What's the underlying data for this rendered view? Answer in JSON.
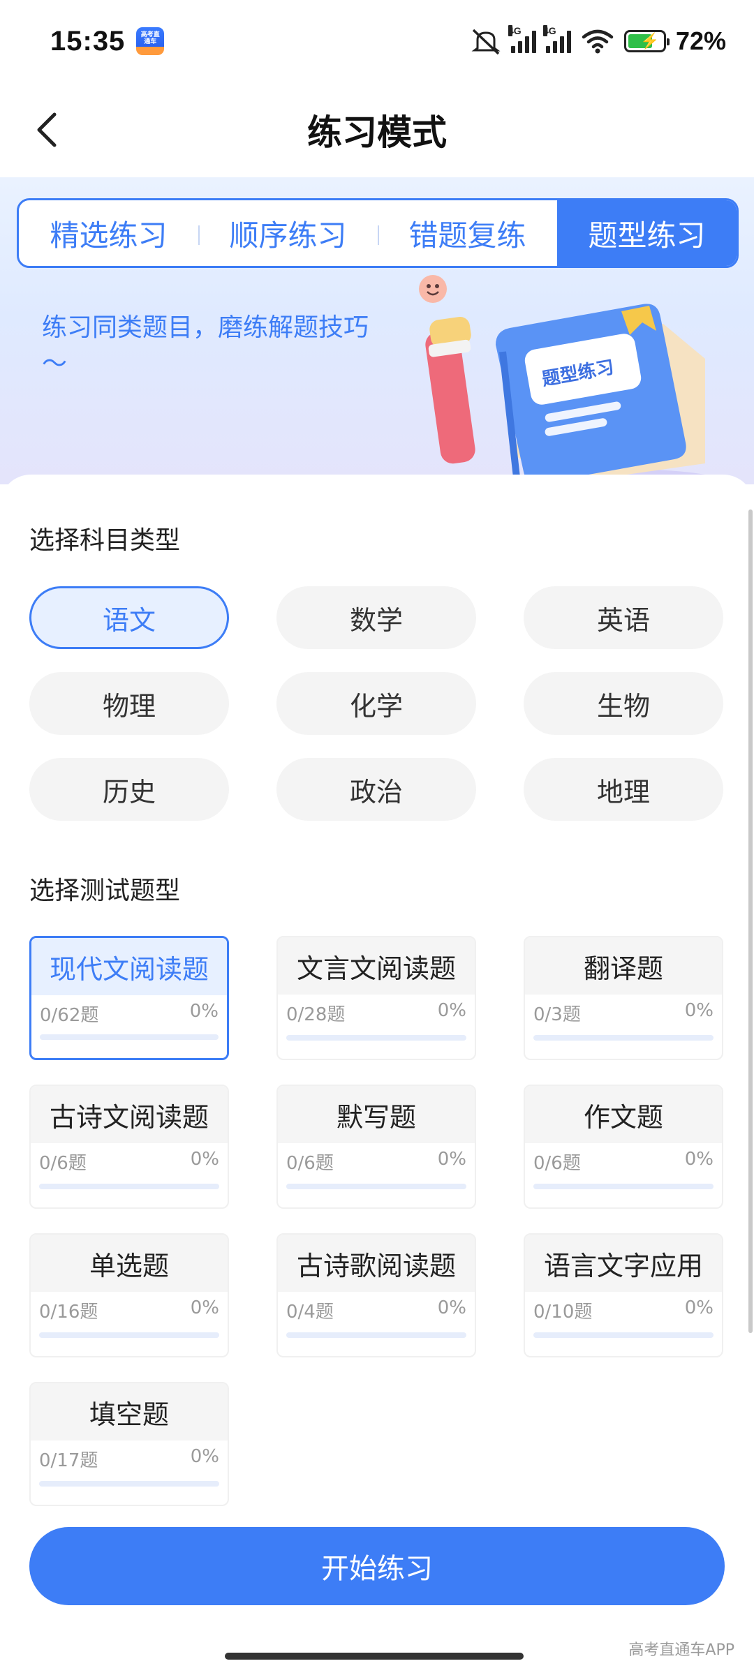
{
  "status_bar": {
    "time": "15:35",
    "app_icon_text": "高考直通车",
    "battery_percent": "72%",
    "battery_level": 0.72,
    "network_labels": [
      "4G",
      "4G"
    ],
    "icons": [
      "mute-icon",
      "signal-icon",
      "signal-icon",
      "wifi-icon",
      "battery-charging-icon"
    ]
  },
  "nav": {
    "back_icon": "chevron-left-icon",
    "title": "练习模式"
  },
  "hero": {
    "tabs": [
      {
        "label": "精选练习",
        "active": false
      },
      {
        "label": "顺序练习",
        "active": false
      },
      {
        "label": "错题复练",
        "active": false
      },
      {
        "label": "题型练习",
        "active": true
      }
    ],
    "description": "练习同类题目，磨练解题技巧～",
    "illustration_label": "题型练习"
  },
  "subject_section": {
    "title": "选择科目类型",
    "subjects": [
      {
        "label": "语文",
        "active": true
      },
      {
        "label": "数学",
        "active": false
      },
      {
        "label": "英语",
        "active": false
      },
      {
        "label": "物理",
        "active": false
      },
      {
        "label": "化学",
        "active": false
      },
      {
        "label": "生物",
        "active": false
      },
      {
        "label": "历史",
        "active": false
      },
      {
        "label": "政治",
        "active": false
      },
      {
        "label": "地理",
        "active": false
      }
    ]
  },
  "question_type_section": {
    "title": "选择测试题型",
    "types": [
      {
        "name": "现代文阅读题",
        "count": "0/62题",
        "percent": "0%",
        "progress": 0,
        "active": true
      },
      {
        "name": "文言文阅读题",
        "count": "0/28题",
        "percent": "0%",
        "progress": 0,
        "active": false
      },
      {
        "name": "翻译题",
        "count": "0/3题",
        "percent": "0%",
        "progress": 0,
        "active": false
      },
      {
        "name": "古诗文阅读题",
        "count": "0/6题",
        "percent": "0%",
        "progress": 0,
        "active": false
      },
      {
        "name": "默写题",
        "count": "0/6题",
        "percent": "0%",
        "progress": 0,
        "active": false
      },
      {
        "name": "作文题",
        "count": "0/6题",
        "percent": "0%",
        "progress": 0,
        "active": false
      },
      {
        "name": "单选题",
        "count": "0/16题",
        "percent": "0%",
        "progress": 0,
        "active": false
      },
      {
        "name": "古诗歌阅读题",
        "count": "0/4题",
        "percent": "0%",
        "progress": 0,
        "active": false
      },
      {
        "name": "语言文字应用",
        "count": "0/10题",
        "percent": "0%",
        "progress": 0,
        "active": false
      },
      {
        "name": "填空题",
        "count": "0/17题",
        "percent": "0%",
        "progress": 0,
        "active": false
      }
    ]
  },
  "start_button": "开始练习",
  "watermark": "高考直通车APP",
  "colors": {
    "accent": "#3d7df6",
    "accent_light": "#e7f0ff",
    "pill_bg": "#f4f4f4"
  }
}
